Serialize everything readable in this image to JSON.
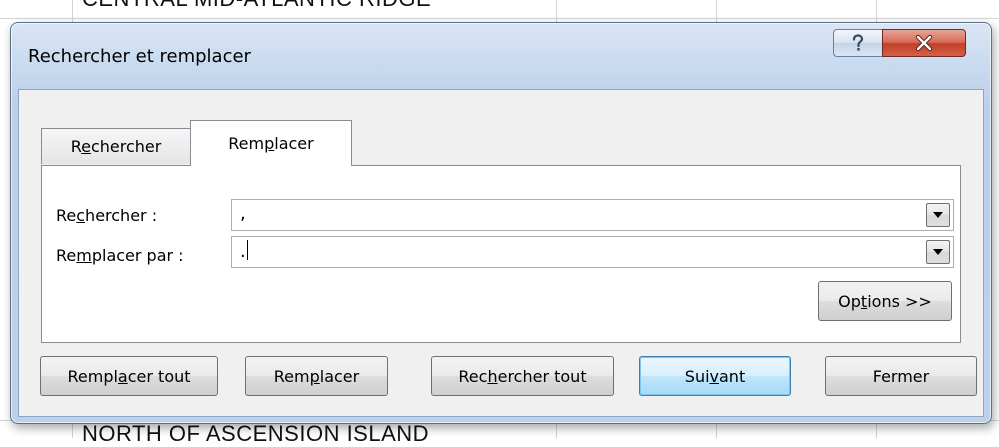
{
  "background": {
    "row_top_text": "CENTRAL MID-ATLANTIC RIDGE",
    "row_bottom_text": "NORTH OF ASCENSION ISLAND"
  },
  "dialog": {
    "title": "Rechercher et remplacer",
    "help_icon": "question-mark-icon",
    "close_icon": "close-x-icon",
    "tabs": [
      {
        "label_before": "R",
        "label_underlined": "e",
        "label_after": "chercher",
        "active": false
      },
      {
        "label_before": "Rem",
        "label_underlined": "p",
        "label_after": "lacer",
        "active": true
      }
    ],
    "find": {
      "label_before": "Re",
      "label_underlined": "c",
      "label_after": "hercher :",
      "value": ","
    },
    "replace": {
      "label_before": "Re",
      "label_underlined": "m",
      "label_after": "placer par :",
      "value": "."
    },
    "options_button": {
      "before": "Op",
      "underlined": "t",
      "after": "ions >>"
    },
    "buttons": {
      "replace_all": {
        "before": "Rempl",
        "underlined": "a",
        "after": "cer tout"
      },
      "replace": {
        "before": "Rem",
        "underlined": "p",
        "after": "lacer"
      },
      "find_all": {
        "before": "Rec",
        "underlined": "h",
        "after": "ercher tout"
      },
      "next": {
        "before": "Sui",
        "underlined": "v",
        "after": "ant"
      },
      "close": {
        "label": "Fermer"
      }
    },
    "colors": {
      "titlebar": "#c9dbef",
      "close_button": "#c2402a",
      "default_button_border": "#3c7fb1"
    }
  }
}
